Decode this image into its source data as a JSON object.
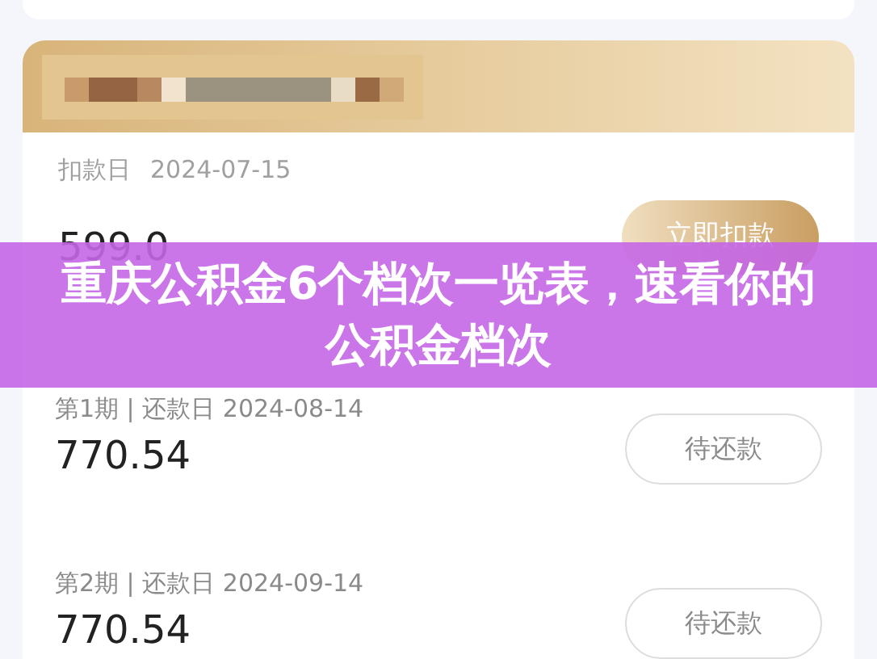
{
  "current": {
    "date_label": "扣款日",
    "date": "2024-07-15",
    "amount": "599.0",
    "button": "立即扣款"
  },
  "installments": [
    {
      "period": "第1期 | 还款日 2024-08-14",
      "amount": "770.54",
      "button": "待还款"
    },
    {
      "period": "第2期 | 还款日 2024-09-14",
      "amount": "770.54",
      "button": "待还款"
    }
  ],
  "banner": {
    "title": "重庆公积金6个档次一览表，速看你的公积金档次"
  }
}
